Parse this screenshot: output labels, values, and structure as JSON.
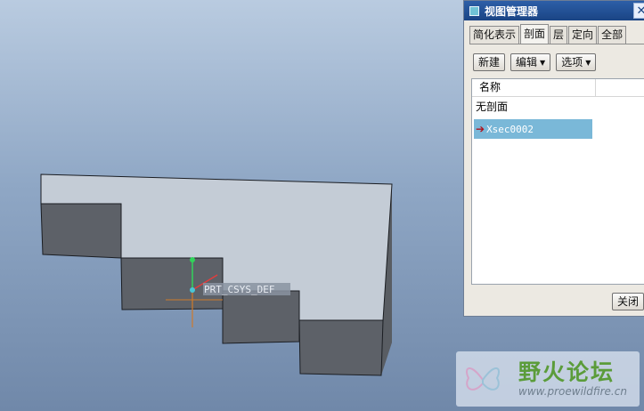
{
  "viewport": {
    "csys_label": "PRT_CSYS_DEF"
  },
  "dialog": {
    "title": "视图管理器",
    "close_glyph": "✕",
    "tabs": [
      {
        "label": "简化表示",
        "active": false
      },
      {
        "label": "剖面",
        "active": true
      },
      {
        "label": "层",
        "active": false
      },
      {
        "label": "定向",
        "active": false
      },
      {
        "label": "全部",
        "active": false
      }
    ],
    "toolbar": {
      "new_label": "新建",
      "edit_label": "编辑",
      "options_label": "选项"
    },
    "list": {
      "header_name": "名称",
      "rows": [
        {
          "label": "无剖面",
          "selected": false
        },
        {
          "label": "Xsec0002",
          "selected": true
        }
      ]
    },
    "close_label": "关闭"
  },
  "watermark": {
    "title": "野火论坛",
    "url": "www.proewildfire.cn"
  },
  "colors": {
    "background_top": "#b9cbe0",
    "model_top_face": "#c4ccd6",
    "model_side_face": "#5d6168",
    "selection": "#7ab8d8",
    "title_bar": "#2d5fa8"
  }
}
